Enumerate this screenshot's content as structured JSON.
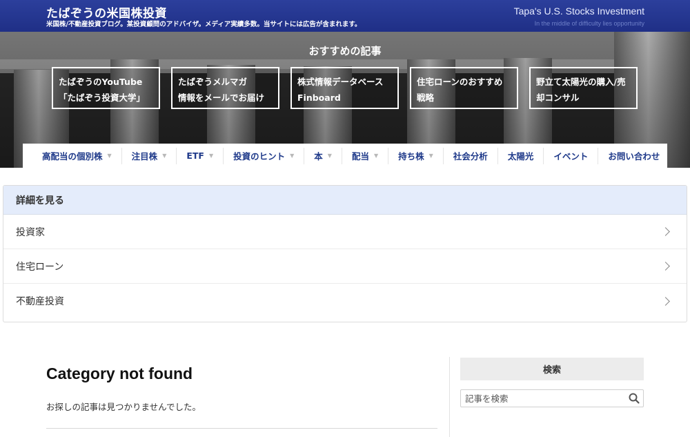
{
  "header": {
    "title": "たばぞうの米国株投資",
    "description": "米国株/不動産投資ブログ。某投資顧問のアドバイザ。メディア実績多数。当サイトには広告が含まれます。",
    "title_en": "Tapa's U.S. Stocks Investment",
    "tagline": "In the middle of difficulty lies opportunity"
  },
  "recommend": {
    "title": "おすすめの記事",
    "items": [
      {
        "line1": "たばぞうのYouTube",
        "line2": "「たばぞう投資大学」"
      },
      {
        "line1": "たばぞうメルマガ",
        "line2": "情報をメールでお届け"
      },
      {
        "line1": "株式情報データベース",
        "line2": "Finboard"
      },
      {
        "line1": "住宅ローンのおすすめ",
        "line2": "戦略"
      },
      {
        "line1": "野立て太陽光の購入/売",
        "line2": "却コンサル"
      }
    ]
  },
  "nav": [
    {
      "label": "高配当の個別株",
      "dropdown": true
    },
    {
      "label": "注目株",
      "dropdown": true
    },
    {
      "label": "ETF",
      "dropdown": true
    },
    {
      "label": "投資のヒント",
      "dropdown": true
    },
    {
      "label": "本",
      "dropdown": true
    },
    {
      "label": "配当",
      "dropdown": true
    },
    {
      "label": "持ち株",
      "dropdown": true
    },
    {
      "label": "社会分析",
      "dropdown": false
    },
    {
      "label": "太陽光",
      "dropdown": false
    },
    {
      "label": "イベント",
      "dropdown": false
    },
    {
      "label": "お問い合わせ",
      "dropdown": false
    }
  ],
  "details": {
    "heading": "詳細を見る",
    "items": [
      "投資家",
      "住宅ローン",
      "不動産投資"
    ]
  },
  "main": {
    "title": "Category not found",
    "message": "お探しの記事は見つかりませんでした。"
  },
  "sidebar": {
    "search_heading": "検索",
    "search_placeholder": "記事を検索"
  },
  "icons": {
    "caret": "caret-down-icon",
    "chevron": "chevron-right-icon",
    "search": "search-icon"
  },
  "colors": {
    "header_bg": "#24358f",
    "nav_text": "#1f3a8a",
    "accordion_head_bg": "#e4ecfb"
  }
}
